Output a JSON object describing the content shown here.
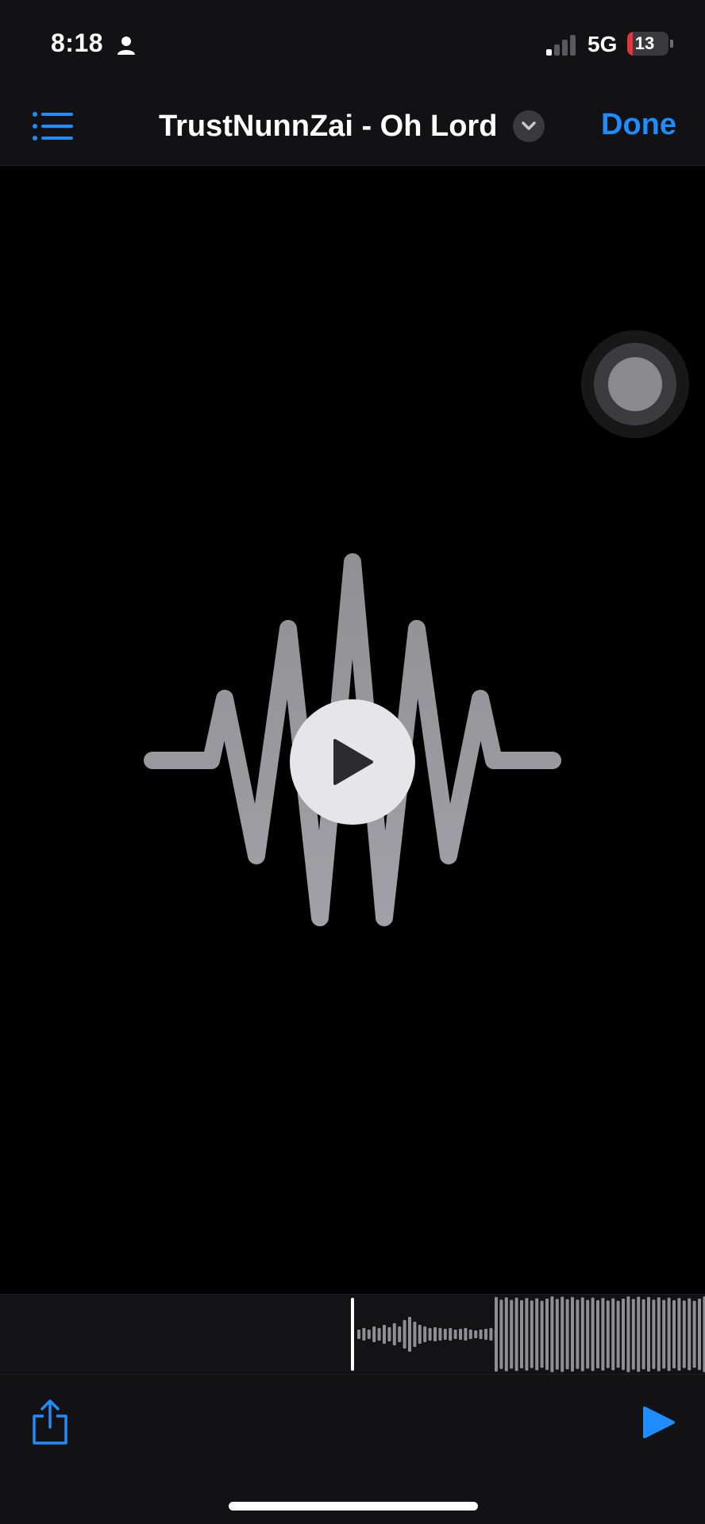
{
  "status_bar": {
    "time": "8:18",
    "network": "5G",
    "battery_level": "13",
    "battery_fraction": 0.13,
    "icons": [
      "person-icon",
      "cellular-signal-icon",
      "battery-charging-icon"
    ]
  },
  "nav_bar": {
    "title": "TrustNunnZai - Oh Lord",
    "done_label": "Done",
    "icons": [
      "list-icon",
      "chevron-down-icon"
    ]
  },
  "player": {
    "icons": [
      "audio-waveform-icon",
      "play-icon"
    ]
  },
  "toolbar": {
    "icons": [
      "share-icon",
      "play-icon"
    ]
  },
  "colors": {
    "accent": "#1f8cff",
    "background": "#000000",
    "bar_background": "#121215",
    "waveform": "#8e8e93",
    "battery_low": "#e5353b"
  }
}
